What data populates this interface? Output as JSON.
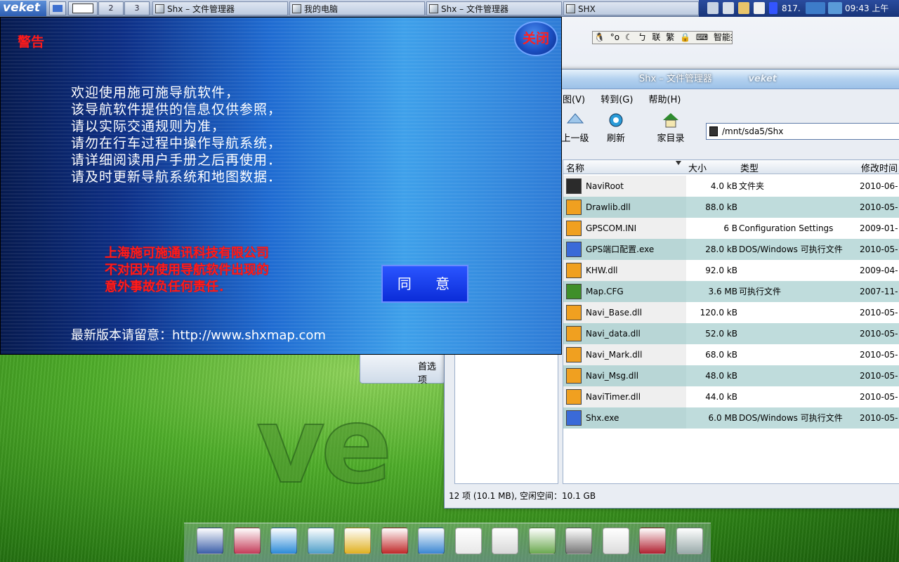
{
  "taskbar": {
    "logo": "veket",
    "pager": [
      "2",
      "3"
    ],
    "tasks": [
      {
        "label": "Shx – 文件管理器"
      },
      {
        "label": "我的电脑"
      },
      {
        "label": "Shx – 文件管理器"
      },
      {
        "label": "SHX"
      }
    ],
    "tray": {
      "cpu": "817.",
      "clock": "09:43 上午"
    }
  },
  "ime": {
    "label": "智能拼音",
    "items": [
      "联",
      "繁"
    ]
  },
  "warning": {
    "title": "警告",
    "close_label": "关闭",
    "lines": [
      "欢迎使用施可施导航软件，",
      "该导航软件提供的信息仅供参照，",
      "请以实际交通规则为准，",
      "请勿在行车过程中操作导航系统，",
      "请详细阅读用户手册之后再使用．",
      "请及时更新导航系统和地图数据．"
    ],
    "disclaimer": [
      "上海施可施通讯科技有限公司",
      "不对因为使用导航软件出现的",
      "意外事故负任何责任．"
    ],
    "agree_label": "同 意",
    "footer": "最新版本请留意：http://www.shxmap.com"
  },
  "pref_window": {
    "label": "首选项"
  },
  "file_manager": {
    "title": "Shx – 文件管理器",
    "title_watermark": "veket",
    "menu": [
      "图(V)",
      "转到(G)",
      "帮助(H)"
    ],
    "toolbar": {
      "up": "上一级",
      "refresh": "刷新",
      "home": "家目录"
    },
    "address": "/mnt/sda5/Shx",
    "columns": {
      "name": "名称",
      "size": "大小",
      "type": "类型",
      "modified": "修改时间"
    },
    "files": [
      {
        "name": "NaviRoot",
        "size": "4.0 kB",
        "type": "文件夹",
        "modified": "2010-06-",
        "icon": "folder-icon"
      },
      {
        "name": "Drawlib.dll",
        "size": "88.0 kB",
        "type": "",
        "modified": "2010-05-",
        "icon": "dll-icon"
      },
      {
        "name": "GPSCOM.INI",
        "size": "6 B",
        "type": "Configuration Settings",
        "modified": "2009-01-",
        "icon": "ini-icon"
      },
      {
        "name": "GPS端口配置.exe",
        "size": "28.0 kB",
        "type": "DOS/Windows 可执行文件",
        "modified": "2010-05-",
        "icon": "exe-icon"
      },
      {
        "name": "KHW.dll",
        "size": "92.0 kB",
        "type": "",
        "modified": "2009-04-",
        "icon": "dll-icon"
      },
      {
        "name": "Map.CFG",
        "size": "3.6 MB",
        "type": "可执行文件",
        "modified": "2007-11-",
        "icon": "cfg-icon"
      },
      {
        "name": "Navi_Base.dll",
        "size": "120.0 kB",
        "type": "",
        "modified": "2010-05-",
        "icon": "dll-icon"
      },
      {
        "name": "Navi_data.dll",
        "size": "52.0 kB",
        "type": "",
        "modified": "2010-05-",
        "icon": "dll-icon"
      },
      {
        "name": "Navi_Mark.dll",
        "size": "68.0 kB",
        "type": "",
        "modified": "2010-05-",
        "icon": "dll-icon"
      },
      {
        "name": "Navi_Msg.dll",
        "size": "48.0 kB",
        "type": "",
        "modified": "2010-05-",
        "icon": "dll-icon"
      },
      {
        "name": "NaviTimer.dll",
        "size": "44.0 kB",
        "type": "",
        "modified": "2010-05-",
        "icon": "dll-icon"
      },
      {
        "name": "Shx.exe",
        "size": "6.0 MB",
        "type": "DOS/Windows 可执行文件",
        "modified": "2010-05-",
        "icon": "exe-icon"
      }
    ],
    "status": "12 项 (10.1 MB), 空闲空间：10.1 GB"
  },
  "dock": {
    "icons": [
      "file-manager-icon",
      "settings-icon",
      "browser-icon",
      "editor-icon",
      "music-icon",
      "tools-icon",
      "chat-icon",
      "document-icon",
      "notes-icon",
      "paint-icon",
      "drive-icon",
      "printer-icon",
      "help-icon",
      "camera-icon"
    ]
  }
}
